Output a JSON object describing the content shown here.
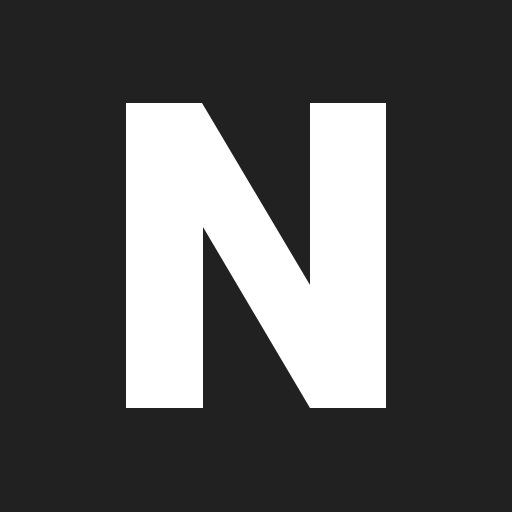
{
  "logo": {
    "letter": "N",
    "glyph_color": "#FFFFFF"
  },
  "colors": {
    "background": "#212121"
  }
}
